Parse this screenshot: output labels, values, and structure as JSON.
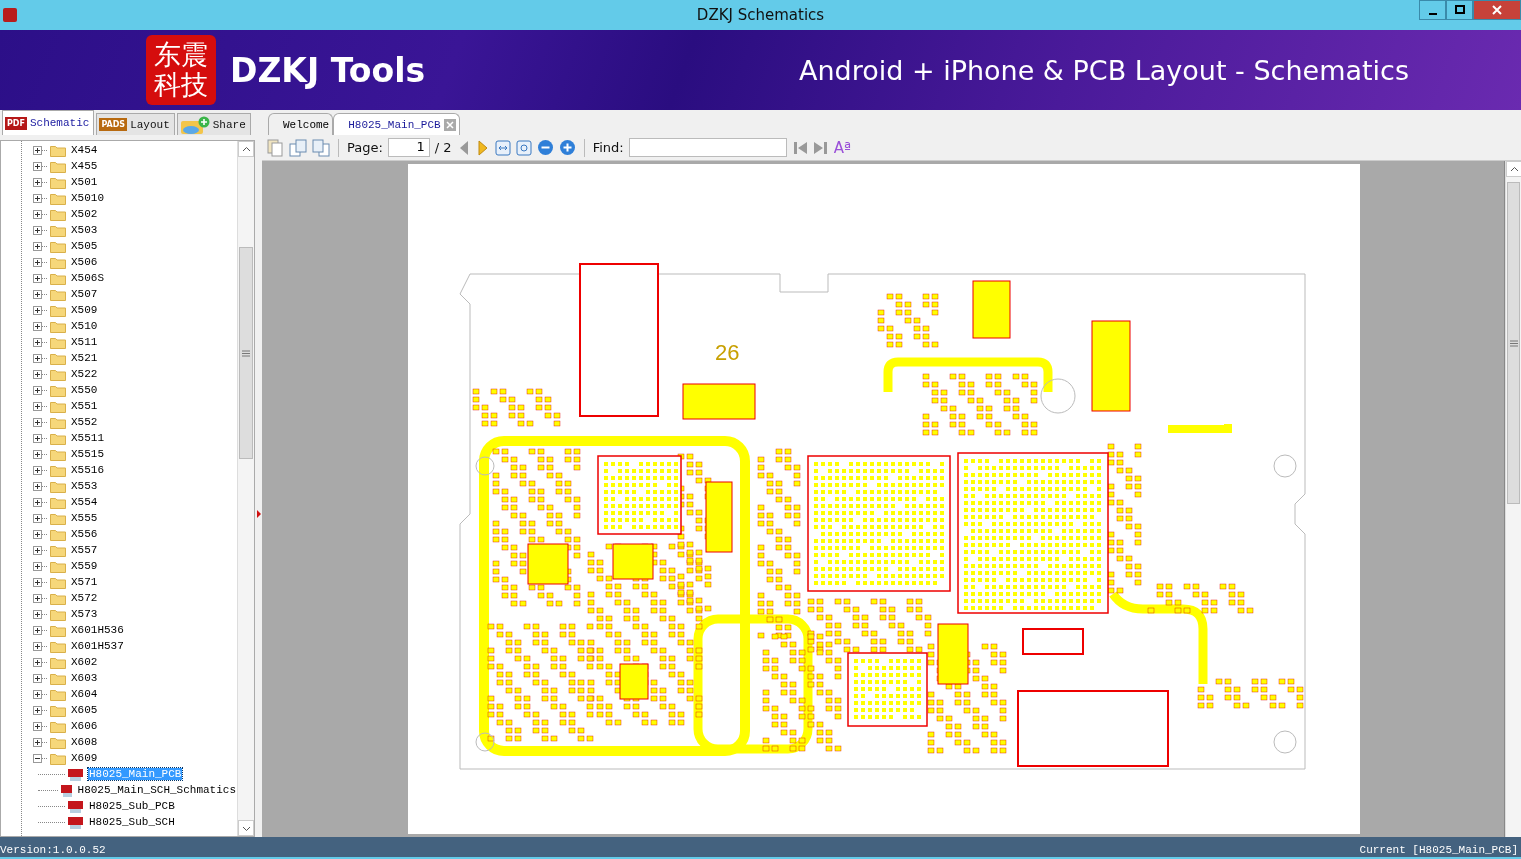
{
  "window": {
    "title": "DZKJ Schematics"
  },
  "banner": {
    "logo_text": "东震科技",
    "brand": "DZKJ Tools",
    "tagline": "Android + iPhone & PCB Layout - Schematics"
  },
  "side_tabs": [
    {
      "label": "Schematic",
      "badge": "PDF",
      "kind": "pdf",
      "selected": true
    },
    {
      "label": "Layout",
      "badge": "PADS",
      "kind": "pads",
      "selected": false
    },
    {
      "label": "Share",
      "kind": "cloud",
      "selected": false
    }
  ],
  "doc_tabs": [
    {
      "label": "Welcome",
      "selected": false,
      "closable": false
    },
    {
      "label": "H8025_Main_PCB",
      "selected": true,
      "closable": true
    }
  ],
  "tree": [
    {
      "label": "X454",
      "expanded": false
    },
    {
      "label": "X455",
      "expanded": false
    },
    {
      "label": "X501",
      "expanded": false
    },
    {
      "label": "X5010",
      "expanded": false
    },
    {
      "label": "X502",
      "expanded": false
    },
    {
      "label": "X503",
      "expanded": false
    },
    {
      "label": "X505",
      "expanded": false
    },
    {
      "label": "X506",
      "expanded": false
    },
    {
      "label": "X506S",
      "expanded": false
    },
    {
      "label": "X507",
      "expanded": false
    },
    {
      "label": "X509",
      "expanded": false
    },
    {
      "label": "X510",
      "expanded": false
    },
    {
      "label": "X511",
      "expanded": false
    },
    {
      "label": "X521",
      "expanded": false
    },
    {
      "label": "X522",
      "expanded": false
    },
    {
      "label": "X550",
      "expanded": false
    },
    {
      "label": "X551",
      "expanded": false
    },
    {
      "label": "X552",
      "expanded": false
    },
    {
      "label": "X5511",
      "expanded": false
    },
    {
      "label": "X5515",
      "expanded": false
    },
    {
      "label": "X5516",
      "expanded": false
    },
    {
      "label": "X553",
      "expanded": false
    },
    {
      "label": "X554",
      "expanded": false
    },
    {
      "label": "X555",
      "expanded": false
    },
    {
      "label": "X556",
      "expanded": false
    },
    {
      "label": "X557",
      "expanded": false
    },
    {
      "label": "X559",
      "expanded": false
    },
    {
      "label": "X571",
      "expanded": false
    },
    {
      "label": "X572",
      "expanded": false
    },
    {
      "label": "X573",
      "expanded": false
    },
    {
      "label": "X601H536",
      "expanded": false
    },
    {
      "label": "X601H537",
      "expanded": false
    },
    {
      "label": "X602",
      "expanded": false
    },
    {
      "label": "X603",
      "expanded": false
    },
    {
      "label": "X604",
      "expanded": false
    },
    {
      "label": "X605",
      "expanded": false
    },
    {
      "label": "X606",
      "expanded": false
    },
    {
      "label": "X608",
      "expanded": false
    },
    {
      "label": "X609",
      "expanded": true,
      "children": [
        {
          "label": "H8025_Main_PCB",
          "selected": true
        },
        {
          "label": "H8025_Main_SCH_Schmatics",
          "selected": false
        },
        {
          "label": "H8025_Sub_PCB",
          "selected": false
        },
        {
          "label": "H8025_Sub_SCH",
          "selected": false
        }
      ]
    }
  ],
  "toolbar": {
    "page_label": "Page:",
    "page_value": "1",
    "page_total": "/ 2",
    "find_label": "Find:",
    "font_glyph": "Aª"
  },
  "pcb": {
    "labels": [
      "26"
    ]
  },
  "status_bar": {
    "version": "Version:1.0.0.52",
    "current": "Current [H8025_Main_PCB]"
  }
}
